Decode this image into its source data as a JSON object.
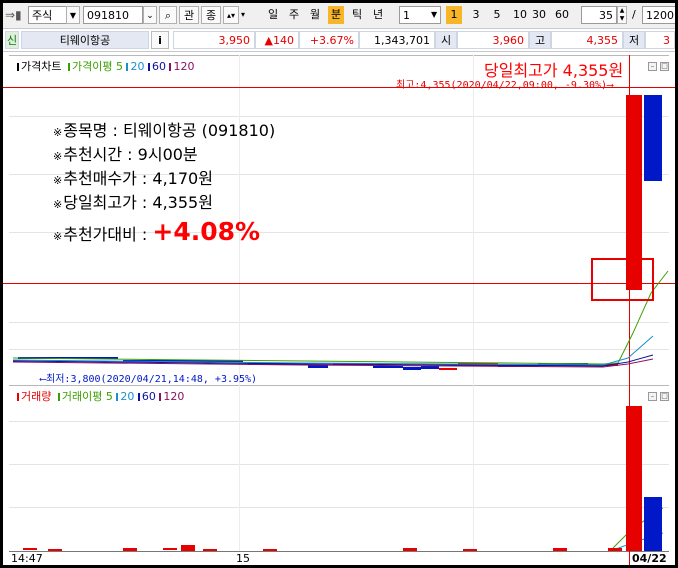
{
  "toolbar": {
    "market_select": "주식",
    "stock_code": "091810",
    "btn_search": "관",
    "btn_company": "종",
    "periods": [
      "일",
      "주",
      "월",
      "분",
      "틱",
      "년"
    ],
    "active_period": "분",
    "interval_value": "1",
    "minute_marker": "1",
    "minute_options": [
      "3",
      "5",
      "10",
      "30",
      "60"
    ],
    "count_value": "35",
    "slash": "/",
    "total_value": "1200"
  },
  "infobar": {
    "badge": "신",
    "stock_name": "티웨이항공",
    "info_btn": "i",
    "price": "3,950",
    "change": "▲140",
    "change_pct": "+3.67%",
    "volume": "1,343,701",
    "open_label": "시",
    "open_value": "3,960",
    "high_label": "고",
    "high_value": "4,355",
    "low_label": "저",
    "low_value_partial": "3"
  },
  "price_panel": {
    "title": "가격차트",
    "legend_prefix": "가격이평",
    "ma": [
      "5",
      "20",
      "60",
      "120"
    ],
    "headline": "당일최고가 4,355원",
    "high_marker": "최고:4,355(2020/04/22,09:00, -9.30%)⟶",
    "low_marker": "⟵최저:3,800(2020/04/21,14:48, +3.95%)"
  },
  "annotation": {
    "prefix": "※",
    "lines": [
      {
        "label": "종목명 : ",
        "value": "티웨이항공 (091810)"
      },
      {
        "label": "추천시간 : ",
        "value": "9시00분"
      },
      {
        "label": "추천매수가 : ",
        "value": "4,170원"
      },
      {
        "label": "당일최고가 : ",
        "value": "4,355원"
      }
    ],
    "rate_label": "추천가대비 : ",
    "rate_value": "+4.08%"
  },
  "volume_panel": {
    "title": "거래량",
    "legend_prefix": "거래이평",
    "ma": [
      "5",
      "20",
      "60",
      "120"
    ]
  },
  "x_axis": [
    "14:47",
    "15",
    "04/22"
  ],
  "colors": {
    "up": "#e60000",
    "down": "#0018c8",
    "ma5": "#3aa000",
    "ma20": "#1a8fd0",
    "ma60": "#1010a0",
    "ma120": "#8a1060",
    "active_period": "#f7b528"
  }
}
